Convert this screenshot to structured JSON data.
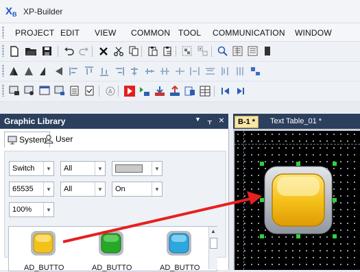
{
  "window": {
    "logo": "XB",
    "title": "XP-Builder"
  },
  "menu": [
    "PROJECT",
    "EDIT",
    "VIEW",
    "COMMON",
    "TOOL",
    "COMMUNICATION",
    "WINDOW"
  ],
  "toolbar1_icons": [
    "new-file-icon",
    "open-folder-icon",
    "save-icon",
    "undo-icon",
    "redo-icon",
    "delete-icon",
    "cut-icon",
    "copy-icon",
    "paste-icon",
    "paste-special-icon",
    "group-icon",
    "ungroup-icon",
    "find-icon",
    "library-icon",
    "library-alt-icon",
    "extra-icon"
  ],
  "toolbar2_icons": [
    "align-left-icon",
    "align-center-icon",
    "align-right-icon",
    "send-left-icon",
    "align-top-icon",
    "align-middle-icon",
    "align-bottom-icon",
    "flip-h-icon",
    "flip-v-icon",
    "space-h-icon",
    "space-v-icon",
    "center-h-icon",
    "center-v-icon",
    "same-width-icon",
    "same-height-icon",
    "same-size-icon",
    "grid-icon"
  ],
  "toolbar3_icons": [
    "screen-icon",
    "screen-list-icon",
    "window-icon",
    "window-list-icon",
    "list-icon",
    "check-icon",
    "font-icon",
    "run-icon",
    "build-icon",
    "download-icon",
    "upload-icon",
    "device-icon",
    "table-icon",
    "first-icon",
    "play-icon"
  ],
  "graphic_library": {
    "title": "Graphic Library",
    "controls": {
      "dropdown": "▼",
      "pin": "ᚁ",
      "close": "×"
    },
    "tabs": {
      "system": "System",
      "user": "User"
    },
    "filters": {
      "row1": {
        "type": "Switch",
        "scope": "All",
        "color": ""
      },
      "row2": {
        "color_code": "65535",
        "scope": "All",
        "state": "On"
      },
      "row3": {
        "zoom": "100%"
      }
    },
    "thumbnails": [
      {
        "label": "AD_BUTTO",
        "color": "#f2c21b"
      },
      {
        "label": "AD_BUTTO",
        "color": "#27a826"
      },
      {
        "label": "AD_BUTTO",
        "color": "#2ea7de"
      }
    ]
  },
  "editor": {
    "tabs": [
      {
        "label": "B-1 *"
      },
      {
        "label": "Text Table_01 *"
      }
    ],
    "selected_button_color": "#f5c21a"
  },
  "annotation_arrow_color": "#e62020"
}
